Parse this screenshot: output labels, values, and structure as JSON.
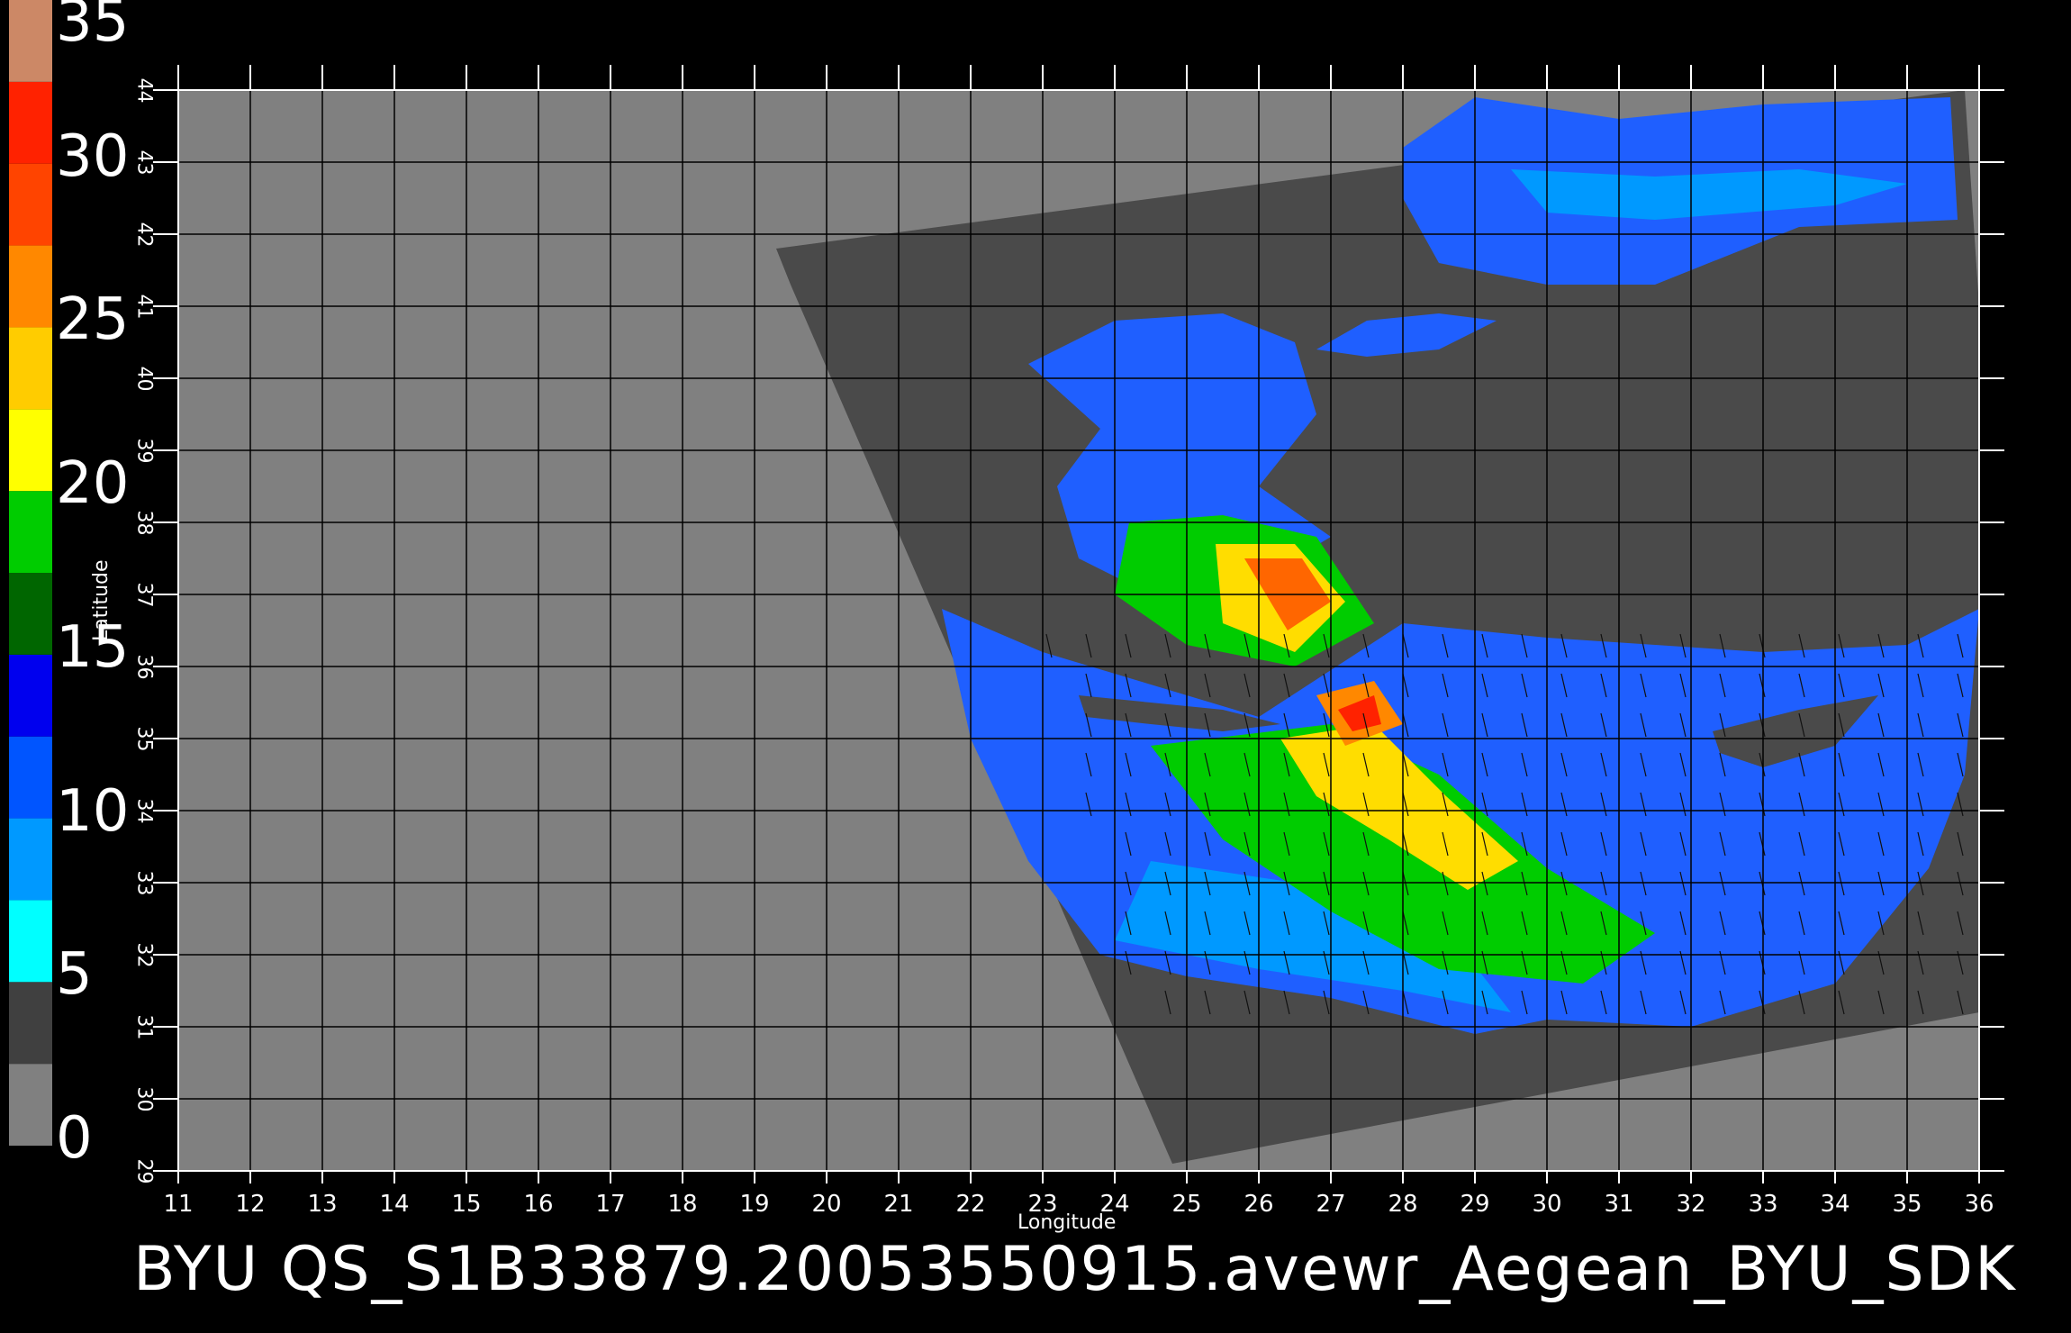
{
  "title_footer": "BYU  QS_S1B33879.20053550915.avewr_Aegean_BYU_SDK",
  "axes": {
    "xlabel": "Longitude",
    "ylabel": "Latitude",
    "x_ticks": [
      "11",
      "12",
      "13",
      "14",
      "15",
      "16",
      "17",
      "18",
      "19",
      "20",
      "21",
      "22",
      "23",
      "24",
      "25",
      "26",
      "27",
      "28",
      "29",
      "30",
      "31",
      "32",
      "33",
      "34",
      "35",
      "36"
    ],
    "y_ticks": [
      "29",
      "30",
      "31",
      "32",
      "33",
      "34",
      "35",
      "36",
      "37",
      "38",
      "39",
      "40",
      "41",
      "42",
      "43",
      "44"
    ],
    "xlim": [
      11,
      36
    ],
    "ylim": [
      29,
      44
    ]
  },
  "colorbar": {
    "labels": [
      "0",
      "5",
      "10",
      "15",
      "20",
      "25",
      "30",
      "35"
    ],
    "segments": [
      {
        "from": 0,
        "to": 2.5,
        "color": "#808080"
      },
      {
        "from": 2.5,
        "to": 5,
        "color": "#404040"
      },
      {
        "from": 5,
        "to": 7.5,
        "color": "#00ffff"
      },
      {
        "from": 7.5,
        "to": 10,
        "color": "#0099ff"
      },
      {
        "from": 10,
        "to": 12.5,
        "color": "#0055ff"
      },
      {
        "from": 12.5,
        "to": 15,
        "color": "#0000ee"
      },
      {
        "from": 15,
        "to": 17.5,
        "color": "#006600"
      },
      {
        "from": 17.5,
        "to": 20,
        "color": "#00cc00"
      },
      {
        "from": 20,
        "to": 22.5,
        "color": "#ffff00"
      },
      {
        "from": 22.5,
        "to": 25,
        "color": "#ffcc00"
      },
      {
        "from": 25,
        "to": 27.5,
        "color": "#ff8800"
      },
      {
        "from": 27.5,
        "to": 30,
        "color": "#ff4400"
      },
      {
        "from": 30,
        "to": 32.5,
        "color": "#ff2200"
      },
      {
        "from": 32.5,
        "to": 35,
        "color": "#cc8866"
      }
    ]
  },
  "colors": {
    "background": "#000000",
    "land_outside_swath": "#808080",
    "swath_land": "#4a4a4a",
    "grid": "#000000"
  }
}
